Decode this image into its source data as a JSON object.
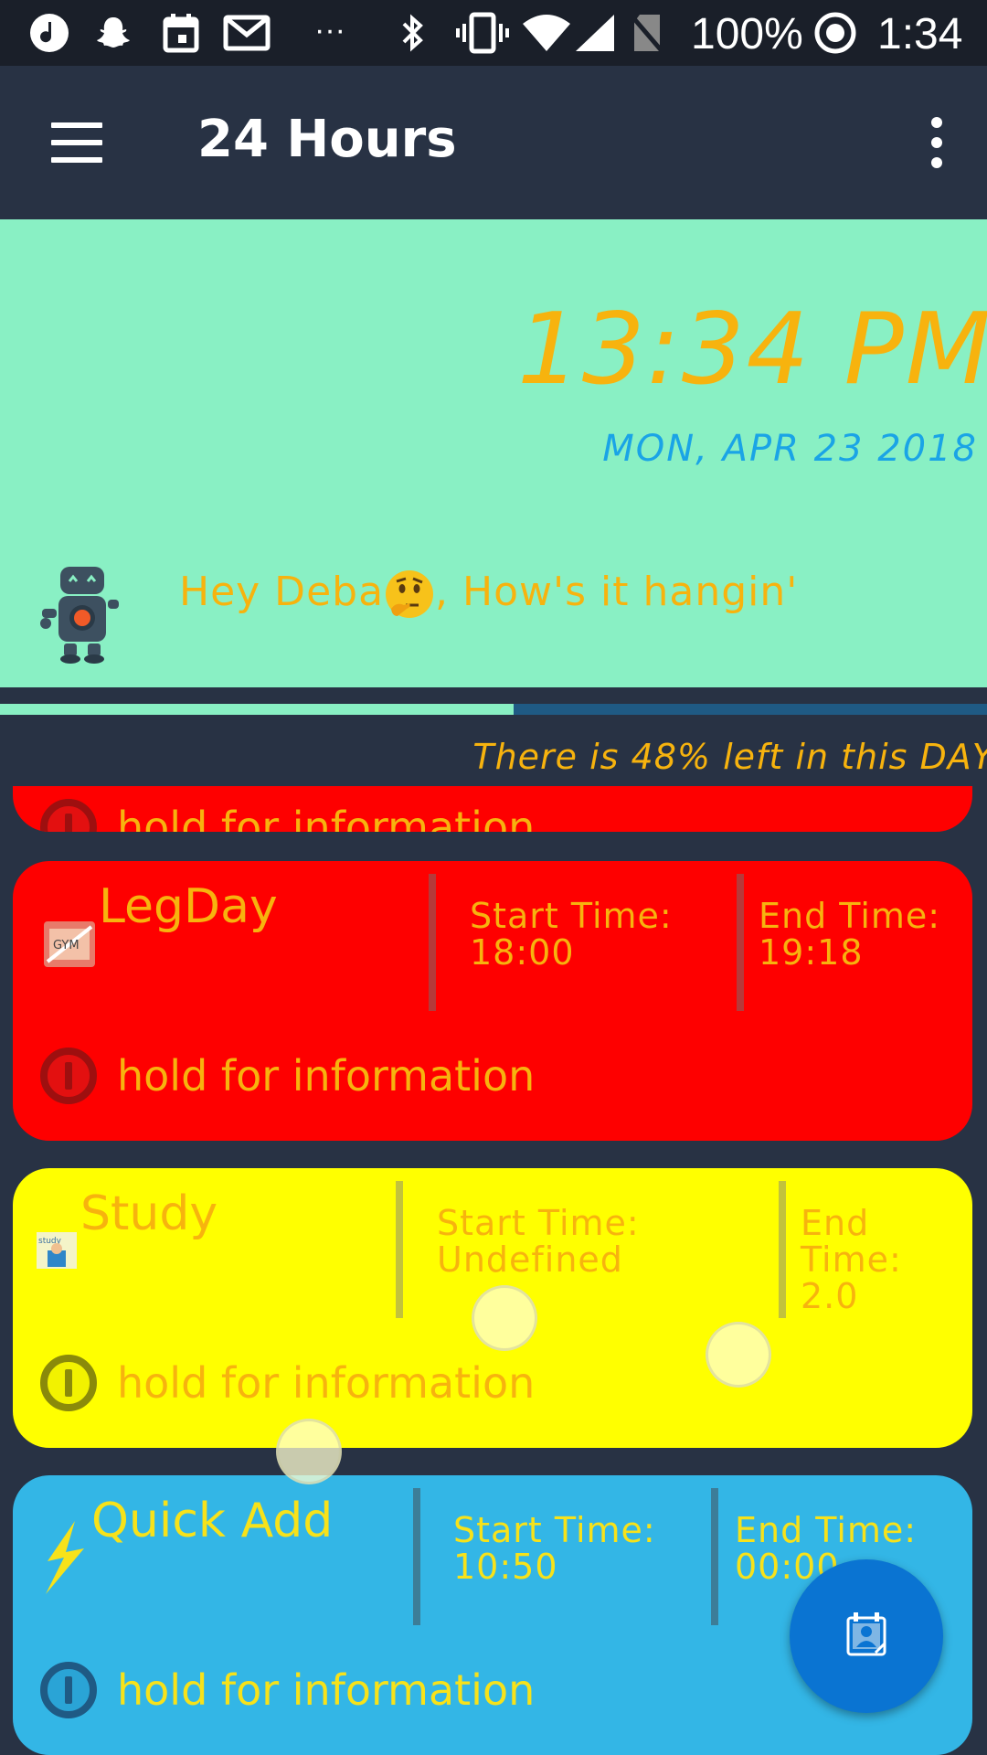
{
  "status_bar": {
    "battery_text": "100%",
    "time": "1:34",
    "more_indicator": "···",
    "icons": [
      "music-app-icon",
      "snapchat-icon",
      "calendar-icon",
      "gmail-icon",
      "bluetooth-icon",
      "vibrate-icon",
      "wifi-icon",
      "signal-icon",
      "no-sim-icon",
      "alarm-icon"
    ]
  },
  "appbar": {
    "title": "24 Hours"
  },
  "header": {
    "clock": "13:34 PM",
    "date": "MON, APR 23 2018",
    "greeting_name": "Hey Deba",
    "greeting_rest": ", How's it hangin'"
  },
  "progress": {
    "elapsed_fraction": 0.52,
    "remaining_text": "There is 48%  left in this DAY"
  },
  "colors": {
    "header_bg": "#89f0c4",
    "accent_orange": "#f7b30e",
    "date_blue": "#1aa4e6",
    "card_red": "#fe0000",
    "card_yellow": "#ffff00",
    "card_blue": "#33b6e6",
    "fab_blue": "#0a74d2"
  },
  "tasks": [
    {
      "name": "",
      "info": "hold for information"
    },
    {
      "name": "LegDay",
      "start_label": "Start Time:",
      "start_value": "18:00",
      "end_label": "End Time:",
      "end_value": "19:18",
      "info": "hold for information",
      "thumb_text": "GYM"
    },
    {
      "name": "Study",
      "start_label": "Start Time:",
      "start_value": "Undefined",
      "end_label": "End",
      "end_label2": "Time:",
      "end_value": "2.0",
      "info": "hold for information",
      "thumb_text": "study"
    },
    {
      "name": "Quick Add",
      "start_label": "Start Time:",
      "start_value": "10:50",
      "end_label": "End Time:",
      "end_value": "00:00",
      "info": "hold for information"
    }
  ],
  "fab": {
    "icon": "calendar-contact-icon"
  }
}
